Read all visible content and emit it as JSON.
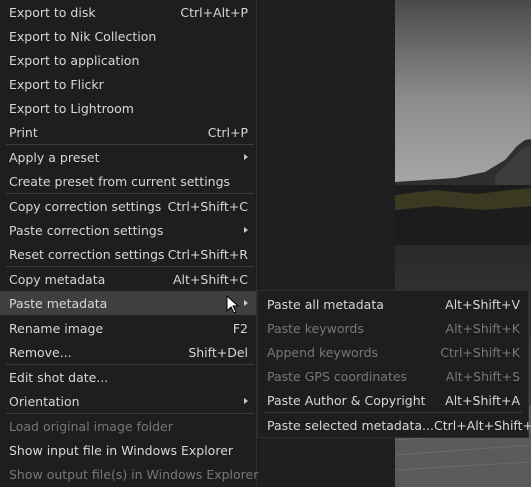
{
  "main_menu": {
    "items": [
      {
        "label": "Export to disk",
        "shortcut": "Ctrl+Alt+P"
      },
      {
        "label": "Export to Nik Collection",
        "shortcut": ""
      },
      {
        "label": "Export to application",
        "shortcut": ""
      },
      {
        "label": "Export to Flickr",
        "shortcut": ""
      },
      {
        "label": "Export to Lightroom",
        "shortcut": ""
      },
      {
        "label": "Print",
        "shortcut": "Ctrl+P"
      },
      {
        "label": "Apply a preset",
        "shortcut": ""
      },
      {
        "label": "Create preset from current settings",
        "shortcut": ""
      },
      {
        "label": "Copy correction settings",
        "shortcut": "Ctrl+Shift+C"
      },
      {
        "label": "Paste correction settings",
        "shortcut": ""
      },
      {
        "label": "Reset correction settings",
        "shortcut": "Ctrl+Shift+R"
      },
      {
        "label": "Copy metadata",
        "shortcut": "Alt+Shift+C"
      },
      {
        "label": "Paste metadata",
        "shortcut": ""
      },
      {
        "label": "Rename image",
        "shortcut": "F2"
      },
      {
        "label": "Remove...",
        "shortcut": "Shift+Del"
      },
      {
        "label": "Edit shot date...",
        "shortcut": ""
      },
      {
        "label": "Orientation",
        "shortcut": ""
      },
      {
        "label": "Load original image folder",
        "shortcut": ""
      },
      {
        "label": "Show input file in Windows Explorer",
        "shortcut": ""
      },
      {
        "label": "Show output file(s) in Windows Explorer",
        "shortcut": ""
      }
    ]
  },
  "sub_menu": {
    "items": [
      {
        "label": "Paste all metadata",
        "shortcut": "Alt+Shift+V"
      },
      {
        "label": "Paste keywords",
        "shortcut": "Alt+Shift+K"
      },
      {
        "label": "Append keywords",
        "shortcut": "Ctrl+Shift+K"
      },
      {
        "label": "Paste GPS coordinates",
        "shortcut": "Alt+Shift+S"
      },
      {
        "label": "Paste Author & Copyright",
        "shortcut": "Alt+Shift+A"
      },
      {
        "label": "Paste selected metadata...",
        "shortcut": "Ctrl+Alt+Shift+V"
      }
    ]
  },
  "colors": {
    "menu_bg": "#1e1e1e",
    "highlight": "#3f3f3f",
    "text": "#d7d7d7",
    "disabled_text": "#777777"
  }
}
